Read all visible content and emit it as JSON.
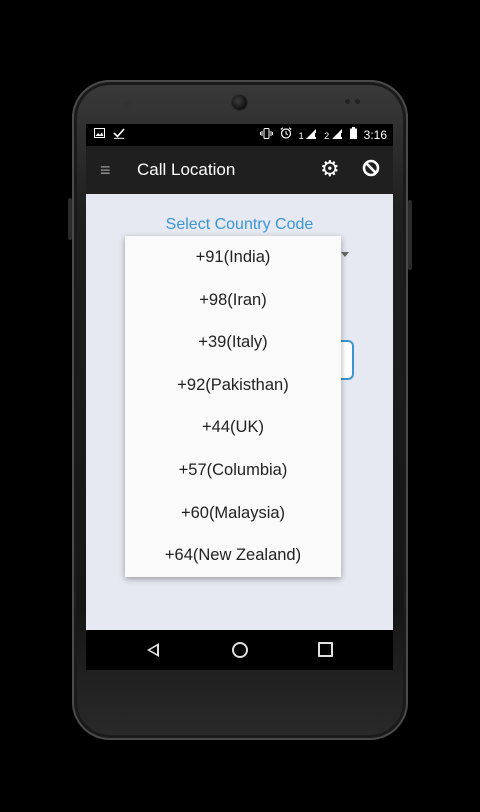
{
  "status_bar": {
    "left_icons": [
      "image-icon",
      "check-icon"
    ],
    "right_icons": [
      "vibrate-icon",
      "alarm-icon",
      "sim1-signal-icon",
      "sim2-signal-icon",
      "battery-icon"
    ],
    "sim1_label": "1",
    "sim2_label": "2",
    "time": "3:16"
  },
  "app_bar": {
    "title": "Call Location",
    "menu_icon": "menu-icon",
    "settings_icon": "gear-icon",
    "block_icon": "block-icon"
  },
  "main": {
    "select_label": "Select Country Code"
  },
  "dropdown": {
    "options": [
      "+91(India)",
      "+98(Iran)",
      "+39(Italy)",
      "+92(Pakisthan)",
      "+44(UK)",
      "+57(Columbia)",
      "+60(Malaysia)",
      "+64(New Zealand)"
    ]
  },
  "nav_bar": {
    "icons": [
      "back-icon",
      "home-icon",
      "recents-icon"
    ]
  },
  "colors": {
    "accent": "#3a96d2",
    "app_bar": "#1f1f1f",
    "background": "#e6e9f2"
  }
}
